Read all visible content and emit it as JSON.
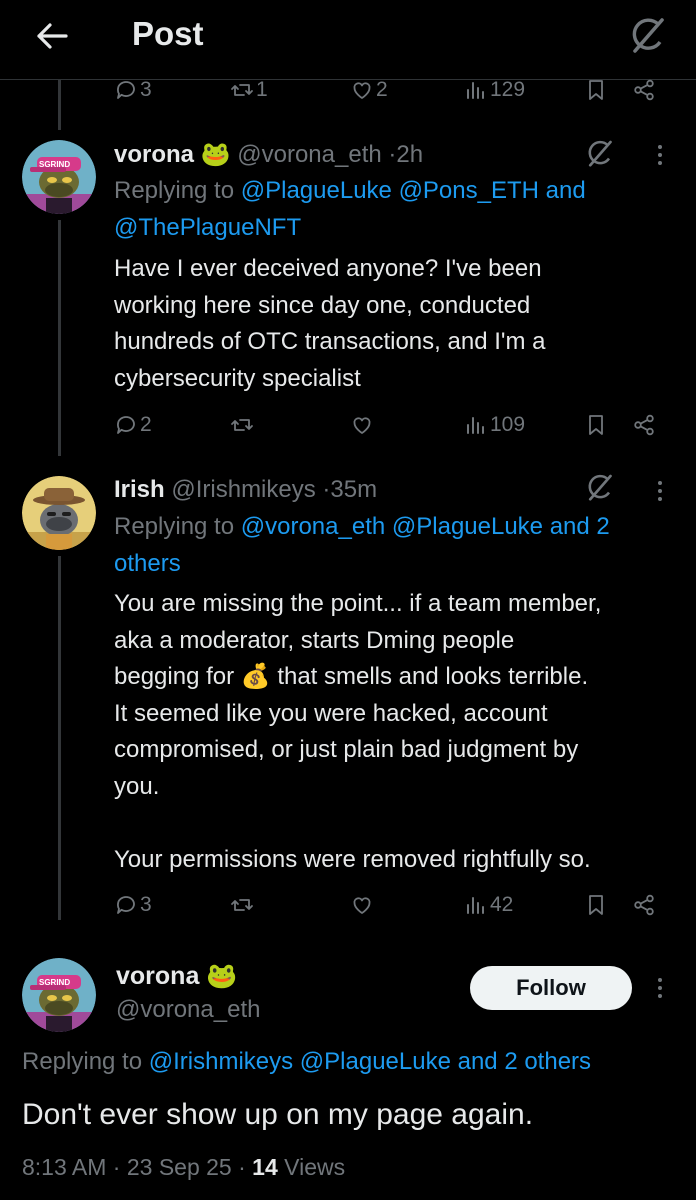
{
  "header": {
    "title": "Post"
  },
  "top_actions": {
    "replies": "3",
    "reposts": "1",
    "likes": "2",
    "views": "129"
  },
  "reply1": {
    "name": "vorona",
    "emoji": "🐸",
    "handle": "@vorona_eth",
    "time": "2h",
    "replying_label": "Replying to",
    "mentions": [
      "@PlagueLuke",
      "@Pons_ETH",
      "@ThePlagueNFT"
    ],
    "and_label": "and",
    "text_lines": [
      "Have I ever deceived anyone? I've been",
      "working here since day one, conducted",
      "hundreds of OTC transactions, and I'm a",
      "cybersecurity specialist"
    ],
    "actions": {
      "replies": "2",
      "reposts": "",
      "likes": "",
      "views": "109"
    }
  },
  "reply2": {
    "name": "Irish",
    "handle": "@Irishmikeys",
    "time": "35m",
    "replying_label": "Replying to",
    "mentions": [
      "@vorona_eth",
      "@PlagueLuke"
    ],
    "others": "and 2 others",
    "text_lines": [
      "You are missing the point... if a team member,",
      "aka a moderator, starts Dming people",
      "begging for 💰 that smells and looks terrible.",
      "It seemed like you were hacked, account",
      "compromised, or just plain bad judgment by",
      "you.",
      "",
      "Your permissions were removed rightfully so."
    ],
    "actions": {
      "replies": "3",
      "reposts": "",
      "likes": "",
      "views": "42"
    }
  },
  "main_post": {
    "name": "vorona",
    "emoji": "🐸",
    "handle": "@vorona_eth",
    "follow_label": "Follow",
    "replying_label": "Replying to",
    "mentions": [
      "@Irishmikeys",
      "@PlagueLuke"
    ],
    "others": "and 2 others",
    "text": "Don't ever show up on my page again.",
    "time": "8:13 AM",
    "date": "23 Sep 25",
    "views_count": "14",
    "views_label": "Views"
  },
  "avatar_texts": {
    "cap_text": "SGRIND"
  },
  "colors": {
    "accent": "#1d9bf0",
    "muted": "#71767b",
    "text": "#e7e9ea",
    "background": "#000000"
  }
}
